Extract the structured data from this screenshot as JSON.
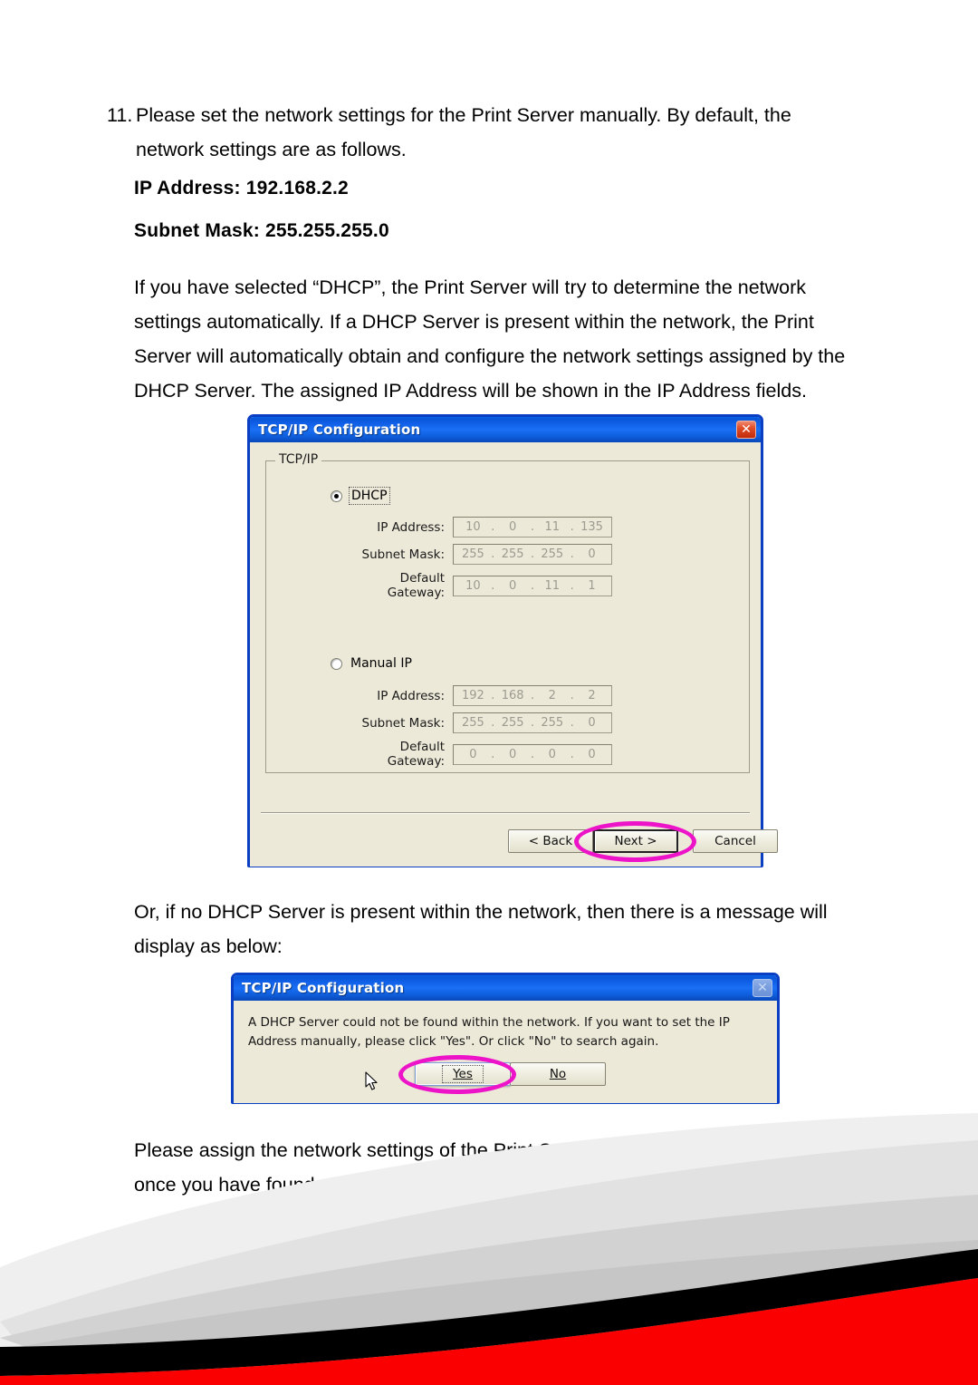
{
  "document": {
    "list_number": "11.",
    "list_text": "Please set the network settings for the Print Server manually. By default, the network settings are as follows.",
    "ip_address_line": "IP Address: 192.168.2.2",
    "subnet_mask_line": "Subnet Mask: 255.255.255.0",
    "dhcp_explain": "If you have selected “DHCP”, the Print Server will try to determine the network settings automatically. If a DHCP Server is present within the network, the Print Server will automatically obtain and configure the network settings assigned by the DHCP Server. The assigned IP Address will be shown in the IP Address fields.",
    "or_no_dhcp": "Or, if no DHCP Server is present within the network, then there is a message will display as below:",
    "assign_manually": "Please assign the network settings of the Print Server manually. Please click “Next” once you have found appropriate network settings for the Print Server."
  },
  "config_dialog": {
    "title": "TCP/IP Configuration",
    "close_icon": "close-icon",
    "groupbox_title": "TCP/IP",
    "dhcp": {
      "radio_label": "DHCP",
      "selected": true,
      "fields": [
        {
          "label": "IP Address:",
          "octets": [
            "10",
            "0",
            "11",
            "135"
          ]
        },
        {
          "label": "Subnet Mask:",
          "octets": [
            "255",
            "255",
            "255",
            "0"
          ]
        },
        {
          "label": "Default Gateway:",
          "octets": [
            "10",
            "0",
            "11",
            "1"
          ]
        }
      ]
    },
    "manual": {
      "radio_label": "Manual IP",
      "selected": false,
      "fields": [
        {
          "label": "IP Address:",
          "octets": [
            "192",
            "168",
            "2",
            "2"
          ]
        },
        {
          "label": "Subnet Mask:",
          "octets": [
            "255",
            "255",
            "255",
            "0"
          ]
        },
        {
          "label": "Default Gateway:",
          "octets": [
            "0",
            "0",
            "0",
            "0"
          ]
        }
      ]
    },
    "buttons": {
      "back": "< Back",
      "next": "Next >",
      "cancel": "Cancel"
    }
  },
  "message_dialog": {
    "title": "TCP/IP Configuration",
    "close_icon": "close-icon",
    "message": "A DHCP Server could not be found within the network. If you want to set the IP Address manually, please click \"Yes\". Or click \"No\" to search again.",
    "buttons": {
      "yes": "Yes",
      "no": "No"
    }
  },
  "colors": {
    "highlight": "#ec13c8",
    "titlebar_blue": "#1060e8",
    "dialog_face": "#ece9d8",
    "footer_red": "#fb0000",
    "footer_black": "#000000"
  }
}
